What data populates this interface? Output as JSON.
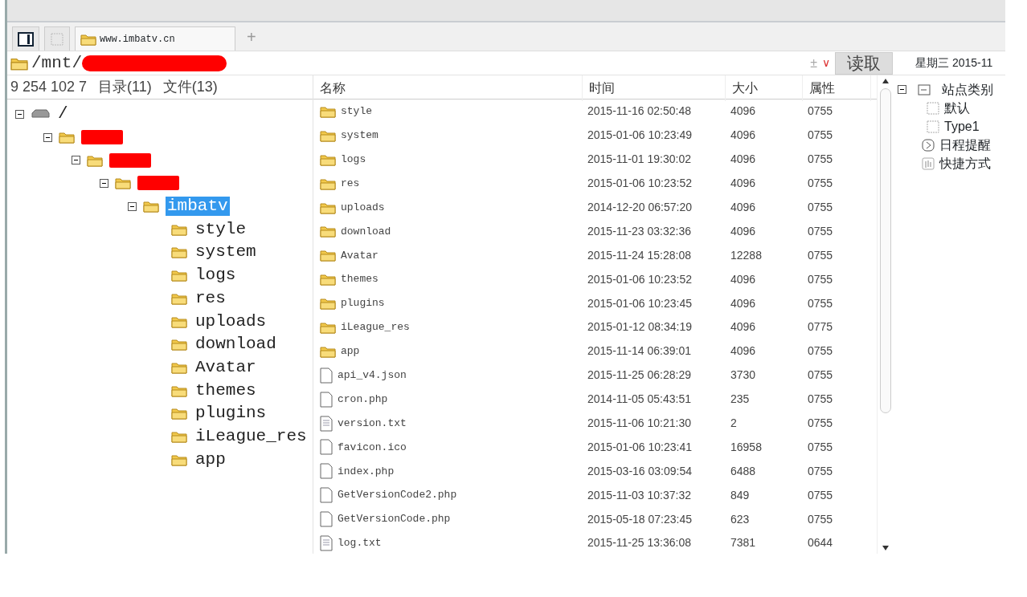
{
  "tabs": [
    {
      "kind": "panel",
      "selected": false
    },
    {
      "kind": "blank",
      "selected": false
    },
    {
      "kind": "site",
      "label": "www.imbatv.cn",
      "selected": true
    }
  ],
  "new_tab": "+",
  "address": {
    "path": "/mnt/",
    "redacted": true,
    "plus_minus": "±",
    "dropdown": "∨",
    "read_button": "读取"
  },
  "date": "星期三 2015-11",
  "status": {
    "host": "9 254 102 7",
    "dirs": "目录(11)",
    "files": "文件(13)"
  },
  "tree": [
    {
      "kind": "drive",
      "label": "/",
      "expanded": true,
      "selected": false,
      "children": [
        {
          "kind": "folder",
          "redacted": true,
          "expanded": true,
          "selected": false,
          "children": [
            {
              "kind": "folder",
              "redacted": true,
              "expanded": true,
              "selected": false,
              "children": [
                {
                  "kind": "folder",
                  "redacted": true,
                  "expanded": true,
                  "selected": false,
                  "children": [
                    {
                      "kind": "folder",
                      "label": "imbatv",
                      "expanded": true,
                      "selected": true,
                      "children": [
                        {
                          "kind": "folder",
                          "label": "style",
                          "selected": false
                        },
                        {
                          "kind": "folder",
                          "label": "system",
                          "selected": false
                        },
                        {
                          "kind": "folder",
                          "label": "logs",
                          "selected": false
                        },
                        {
                          "kind": "folder",
                          "label": "res",
                          "selected": false
                        },
                        {
                          "kind": "folder",
                          "label": "uploads",
                          "selected": false
                        },
                        {
                          "kind": "folder",
                          "label": "download",
                          "selected": false
                        },
                        {
                          "kind": "folder",
                          "label": "Avatar",
                          "selected": false
                        },
                        {
                          "kind": "folder",
                          "label": "themes",
                          "selected": false
                        },
                        {
                          "kind": "folder",
                          "label": "plugins",
                          "selected": false
                        },
                        {
                          "kind": "folder",
                          "label": "iLeague_res",
                          "selected": false
                        },
                        {
                          "kind": "folder",
                          "label": "app",
                          "selected": false
                        }
                      ]
                    }
                  ]
                }
              ]
            }
          ]
        }
      ]
    }
  ],
  "table": {
    "columns": [
      "名称",
      "时间",
      "大小",
      "属性"
    ],
    "rows": [
      {
        "kind": "folder",
        "name": "style",
        "time": "2015-11-16 02:50:48",
        "size": "4096",
        "mode": "0755"
      },
      {
        "kind": "folder",
        "name": "system",
        "time": "2015-01-06 10:23:49",
        "size": "4096",
        "mode": "0755"
      },
      {
        "kind": "folder",
        "name": "logs",
        "time": "2015-11-01 19:30:02",
        "size": "4096",
        "mode": "0755"
      },
      {
        "kind": "folder",
        "name": "res",
        "time": "2015-01-06 10:23:52",
        "size": "4096",
        "mode": "0755"
      },
      {
        "kind": "folder",
        "name": "uploads",
        "time": "2014-12-20 06:57:20",
        "size": "4096",
        "mode": "0755"
      },
      {
        "kind": "folder",
        "name": "download",
        "time": "2015-11-23 03:32:36",
        "size": "4096",
        "mode": "0755"
      },
      {
        "kind": "folder",
        "name": "Avatar",
        "time": "2015-11-24 15:28:08",
        "size": "12288",
        "mode": "0755"
      },
      {
        "kind": "folder",
        "name": "themes",
        "time": "2015-01-06 10:23:52",
        "size": "4096",
        "mode": "0755"
      },
      {
        "kind": "folder",
        "name": "plugins",
        "time": "2015-01-06 10:23:45",
        "size": "4096",
        "mode": "0755"
      },
      {
        "kind": "folder",
        "name": "iLeague_res",
        "time": "2015-01-12 08:34:19",
        "size": "4096",
        "mode": "0775"
      },
      {
        "kind": "folder",
        "name": "app",
        "time": "2015-11-14 06:39:01",
        "size": "4096",
        "mode": "0755"
      },
      {
        "kind": "file",
        "name": "api_v4.json",
        "time": "2015-11-25 06:28:29",
        "size": "3730",
        "mode": "0755"
      },
      {
        "kind": "file",
        "name": "cron.php",
        "time": "2014-11-05 05:43:51",
        "size": "235",
        "mode": "0755"
      },
      {
        "kind": "text",
        "name": "version.txt",
        "time": "2015-11-06 10:21:30",
        "size": "2",
        "mode": "0755"
      },
      {
        "kind": "file",
        "name": "favicon.ico",
        "time": "2015-01-06 10:23:41",
        "size": "16958",
        "mode": "0755"
      },
      {
        "kind": "file",
        "name": "index.php",
        "time": "2015-03-16 03:09:54",
        "size": "6488",
        "mode": "0755"
      },
      {
        "kind": "file",
        "name": "GetVersionCode2.php",
        "time": "2015-11-03 10:37:32",
        "size": "849",
        "mode": "0755"
      },
      {
        "kind": "file",
        "name": "GetVersionCode.php",
        "time": "2015-05-18 07:23:45",
        "size": "623",
        "mode": "0755"
      },
      {
        "kind": "text",
        "name": "log.txt",
        "time": "2015-11-25 13:36:08",
        "size": "7381",
        "mode": "0644"
      }
    ]
  },
  "side_tree": [
    {
      "kind": "category",
      "label": "站点类别",
      "expanded": true,
      "children": [
        {
          "kind": "item",
          "label": "默认"
        },
        {
          "kind": "item",
          "label": "Type1"
        }
      ]
    },
    {
      "kind": "schedule",
      "label": "日程提醒"
    },
    {
      "kind": "shortcut",
      "label": "快捷方式"
    }
  ]
}
